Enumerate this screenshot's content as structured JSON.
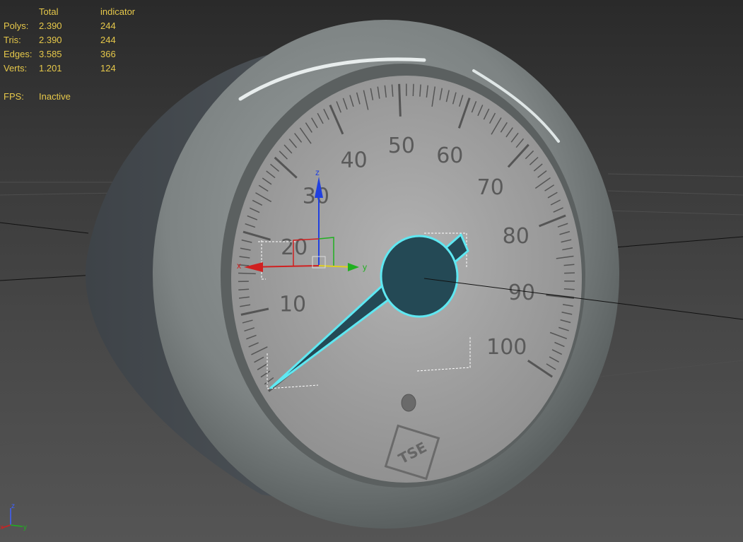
{
  "stats": {
    "headers": [
      "Total",
      "indicator"
    ],
    "rows": [
      {
        "label": "Polys:",
        "total": "2.390",
        "selected": "244"
      },
      {
        "label": "Tris:",
        "total": "2.390",
        "selected": "244"
      },
      {
        "label": "Edges:",
        "total": "3.585",
        "selected": "366"
      },
      {
        "label": "Verts:",
        "total": "1.201",
        "selected": "124"
      }
    ],
    "fps_label": "FPS:",
    "fps_value": "Inactive"
  },
  "gauge": {
    "numbers": [
      "10",
      "20",
      "30",
      "40",
      "50",
      "60",
      "70",
      "80",
      "90",
      "100"
    ],
    "logo": "TSE",
    "needle_value": 6
  },
  "gizmo": {
    "x": "x",
    "y": "y",
    "z": "z"
  },
  "tripod": {
    "x": "x",
    "y": "y",
    "z": "z"
  },
  "colors": {
    "stats_text": "#e6c84a",
    "selection": "#5fe8f2",
    "axis_x": "#d02020",
    "axis_y": "#20b020",
    "axis_z": "#2040e0"
  }
}
